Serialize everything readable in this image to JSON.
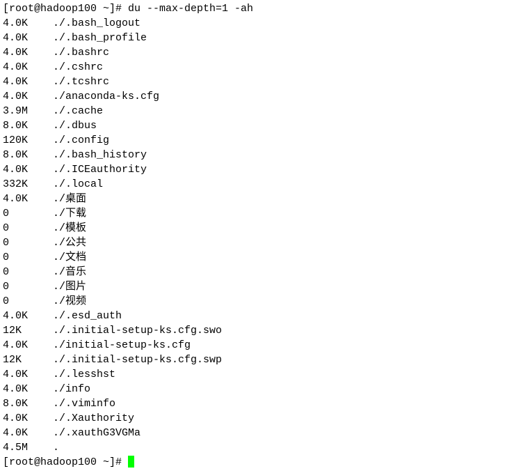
{
  "prompt": {
    "user": "root",
    "host": "hadoop100",
    "dir": "~",
    "symbol": "#",
    "full": "[root@hadoop100 ~]# "
  },
  "command": "du --max-depth=1 -ah",
  "rows": [
    {
      "size": "4.0K",
      "path": "./.bash_logout"
    },
    {
      "size": "4.0K",
      "path": "./.bash_profile"
    },
    {
      "size": "4.0K",
      "path": "./.bashrc"
    },
    {
      "size": "4.0K",
      "path": "./.cshrc"
    },
    {
      "size": "4.0K",
      "path": "./.tcshrc"
    },
    {
      "size": "4.0K",
      "path": "./anaconda-ks.cfg"
    },
    {
      "size": "3.9M",
      "path": "./.cache"
    },
    {
      "size": "8.0K",
      "path": "./.dbus"
    },
    {
      "size": "120K",
      "path": "./.config"
    },
    {
      "size": "8.0K",
      "path": "./.bash_history"
    },
    {
      "size": "4.0K",
      "path": "./.ICEauthority"
    },
    {
      "size": "332K",
      "path": "./.local"
    },
    {
      "size": "4.0K",
      "path": "./桌面"
    },
    {
      "size": "0",
      "path": "./下载"
    },
    {
      "size": "0",
      "path": "./模板"
    },
    {
      "size": "0",
      "path": "./公共"
    },
    {
      "size": "0",
      "path": "./文档"
    },
    {
      "size": "0",
      "path": "./音乐"
    },
    {
      "size": "0",
      "path": "./图片"
    },
    {
      "size": "0",
      "path": "./视频"
    },
    {
      "size": "4.0K",
      "path": "./.esd_auth"
    },
    {
      "size": "12K",
      "path": "./.initial-setup-ks.cfg.swo"
    },
    {
      "size": "4.0K",
      "path": "./initial-setup-ks.cfg"
    },
    {
      "size": "12K",
      "path": "./.initial-setup-ks.cfg.swp"
    },
    {
      "size": "4.0K",
      "path": "./.lesshst"
    },
    {
      "size": "4.0K",
      "path": "./info"
    },
    {
      "size": "8.0K",
      "path": "./.viminfo"
    },
    {
      "size": "4.0K",
      "path": "./.Xauthority"
    },
    {
      "size": "4.0K",
      "path": "./.xauthG3VGMa"
    },
    {
      "size": "4.5M",
      "path": "."
    }
  ]
}
